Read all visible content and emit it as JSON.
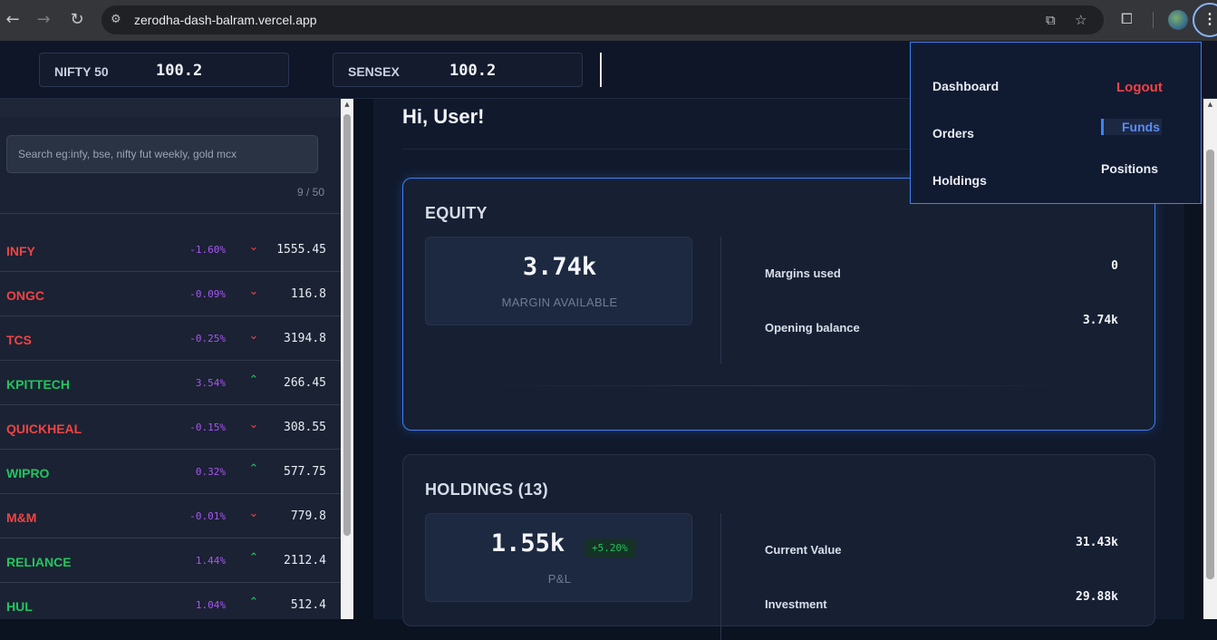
{
  "browser": {
    "url": "zerodha-dash-balram.vercel.app"
  },
  "indices": [
    {
      "name": "NIFTY 50",
      "value": "100.2"
    },
    {
      "name": "SENSEX",
      "value": "100.2"
    }
  ],
  "watchlist": {
    "search_placeholder": "Search eg:infy, bse, nifty fut weekly, gold mcx",
    "count": "9 / 50",
    "stocks": [
      {
        "name": "INFY",
        "pct": "-1.60%",
        "price": "1555.45",
        "direction": "down"
      },
      {
        "name": "ONGC",
        "pct": "-0.09%",
        "price": "116.8",
        "direction": "down"
      },
      {
        "name": "TCS",
        "pct": "-0.25%",
        "price": "3194.8",
        "direction": "down"
      },
      {
        "name": "KPITTECH",
        "pct": "3.54%",
        "price": "266.45",
        "direction": "up"
      },
      {
        "name": "QUICKHEAL",
        "pct": "-0.15%",
        "price": "308.55",
        "direction": "down"
      },
      {
        "name": "WIPRO",
        "pct": "0.32%",
        "price": "577.75",
        "direction": "up"
      },
      {
        "name": "M&M",
        "pct": "-0.01%",
        "price": "779.8",
        "direction": "down"
      },
      {
        "name": "RELIANCE",
        "pct": "1.44%",
        "price": "2112.4",
        "direction": "up"
      },
      {
        "name": "HUL",
        "pct": "1.04%",
        "price": "512.4",
        "direction": "up"
      }
    ]
  },
  "main": {
    "greeting": "Hi, User!",
    "equity": {
      "title": "EQUITY",
      "margin_value": "3.74k",
      "margin_label": "MARGIN AVAILABLE",
      "rows": [
        {
          "label": "Margins used",
          "value": "0"
        },
        {
          "label": "Opening balance",
          "value": "3.74k"
        }
      ]
    },
    "holdings": {
      "title": "HOLDINGS (13)",
      "pnl_value": "1.55k",
      "pnl_badge": "+5.20%",
      "pnl_label": "P&L",
      "rows": [
        {
          "label": "Current Value",
          "value": "31.43k"
        },
        {
          "label": "Investment",
          "value": "29.88k"
        }
      ]
    }
  },
  "menu": {
    "dashboard": "Dashboard",
    "orders": "Orders",
    "holdings": "Holdings",
    "logout": "Logout",
    "funds": "Funds",
    "positions": "Positions"
  }
}
